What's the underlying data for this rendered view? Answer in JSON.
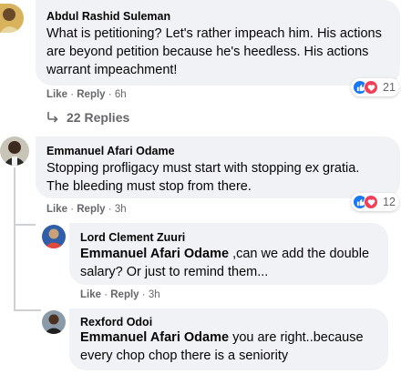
{
  "comments": [
    {
      "author": "Abdul Rashid Suleman",
      "lines": [
        "What is petitioning? Let's rather impeach him. His actions",
        "are beyond petition because he's heedless. His actions",
        "warrant impeachment!"
      ],
      "like_label": "Like",
      "reply_label": "Reply",
      "time": "6h",
      "reaction_count": "21",
      "replies_label": "22 Replies"
    },
    {
      "author": "Emmanuel Afari Odame",
      "lines": [
        "Stopping profligacy must start with stopping ex gratia.",
        "The bleeding must stop from there."
      ],
      "like_label": "Like",
      "reply_label": "Reply",
      "time": "3h",
      "reaction_count": "12"
    }
  ],
  "replies": [
    {
      "author": "Lord Clement Zuuri",
      "mention": "Emmanuel Afari Odame",
      "line1_rest": " ,can we add the double",
      "line2": "salary? Or just to remind them...",
      "like_label": "Like",
      "reply_label": "Reply",
      "time": "3h"
    },
    {
      "author": "Rexford Odoi",
      "mention": "Emmanuel Afari Odame",
      "line1_rest": " you are right..because",
      "line2": "every chop chop there is a seniority"
    }
  ],
  "separator": "·",
  "colors": {
    "bubble": "#f0f2f5",
    "meta_text": "#65676b",
    "like_blue": "#1877f2",
    "love_red": "#f33e58"
  }
}
